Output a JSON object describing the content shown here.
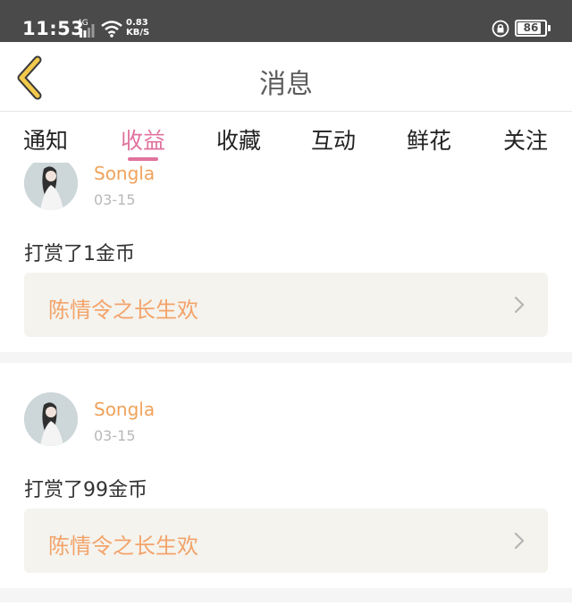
{
  "status_bar": {
    "time": "11:53",
    "network": "4G",
    "speed_value": "0.83",
    "speed_unit": "KB/S",
    "battery": "86",
    "battery_level": 0.86
  },
  "nav": {
    "title": "消息"
  },
  "tabs": [
    {
      "label": "通知",
      "active": false
    },
    {
      "label": "收益",
      "active": true
    },
    {
      "label": "收藏",
      "active": false
    },
    {
      "label": "互动",
      "active": false
    },
    {
      "label": "鲜花",
      "active": false
    },
    {
      "label": "关注",
      "active": false
    }
  ],
  "feed": {
    "items": [
      {
        "user": "Songla",
        "date": "03-15",
        "reward": "打赏了1金币",
        "work": "陈情令之长生欢"
      },
      {
        "user": "Songla",
        "date": "03-15",
        "reward": "打赏了99金币",
        "work": "陈情令之长生欢"
      }
    ]
  },
  "colors": {
    "status_bar": "#4a4a4a",
    "accent": "#e0739e",
    "user_name": "#f0a25a",
    "work_title": "#f3a36a",
    "back_arrow": "#f2c94c"
  }
}
